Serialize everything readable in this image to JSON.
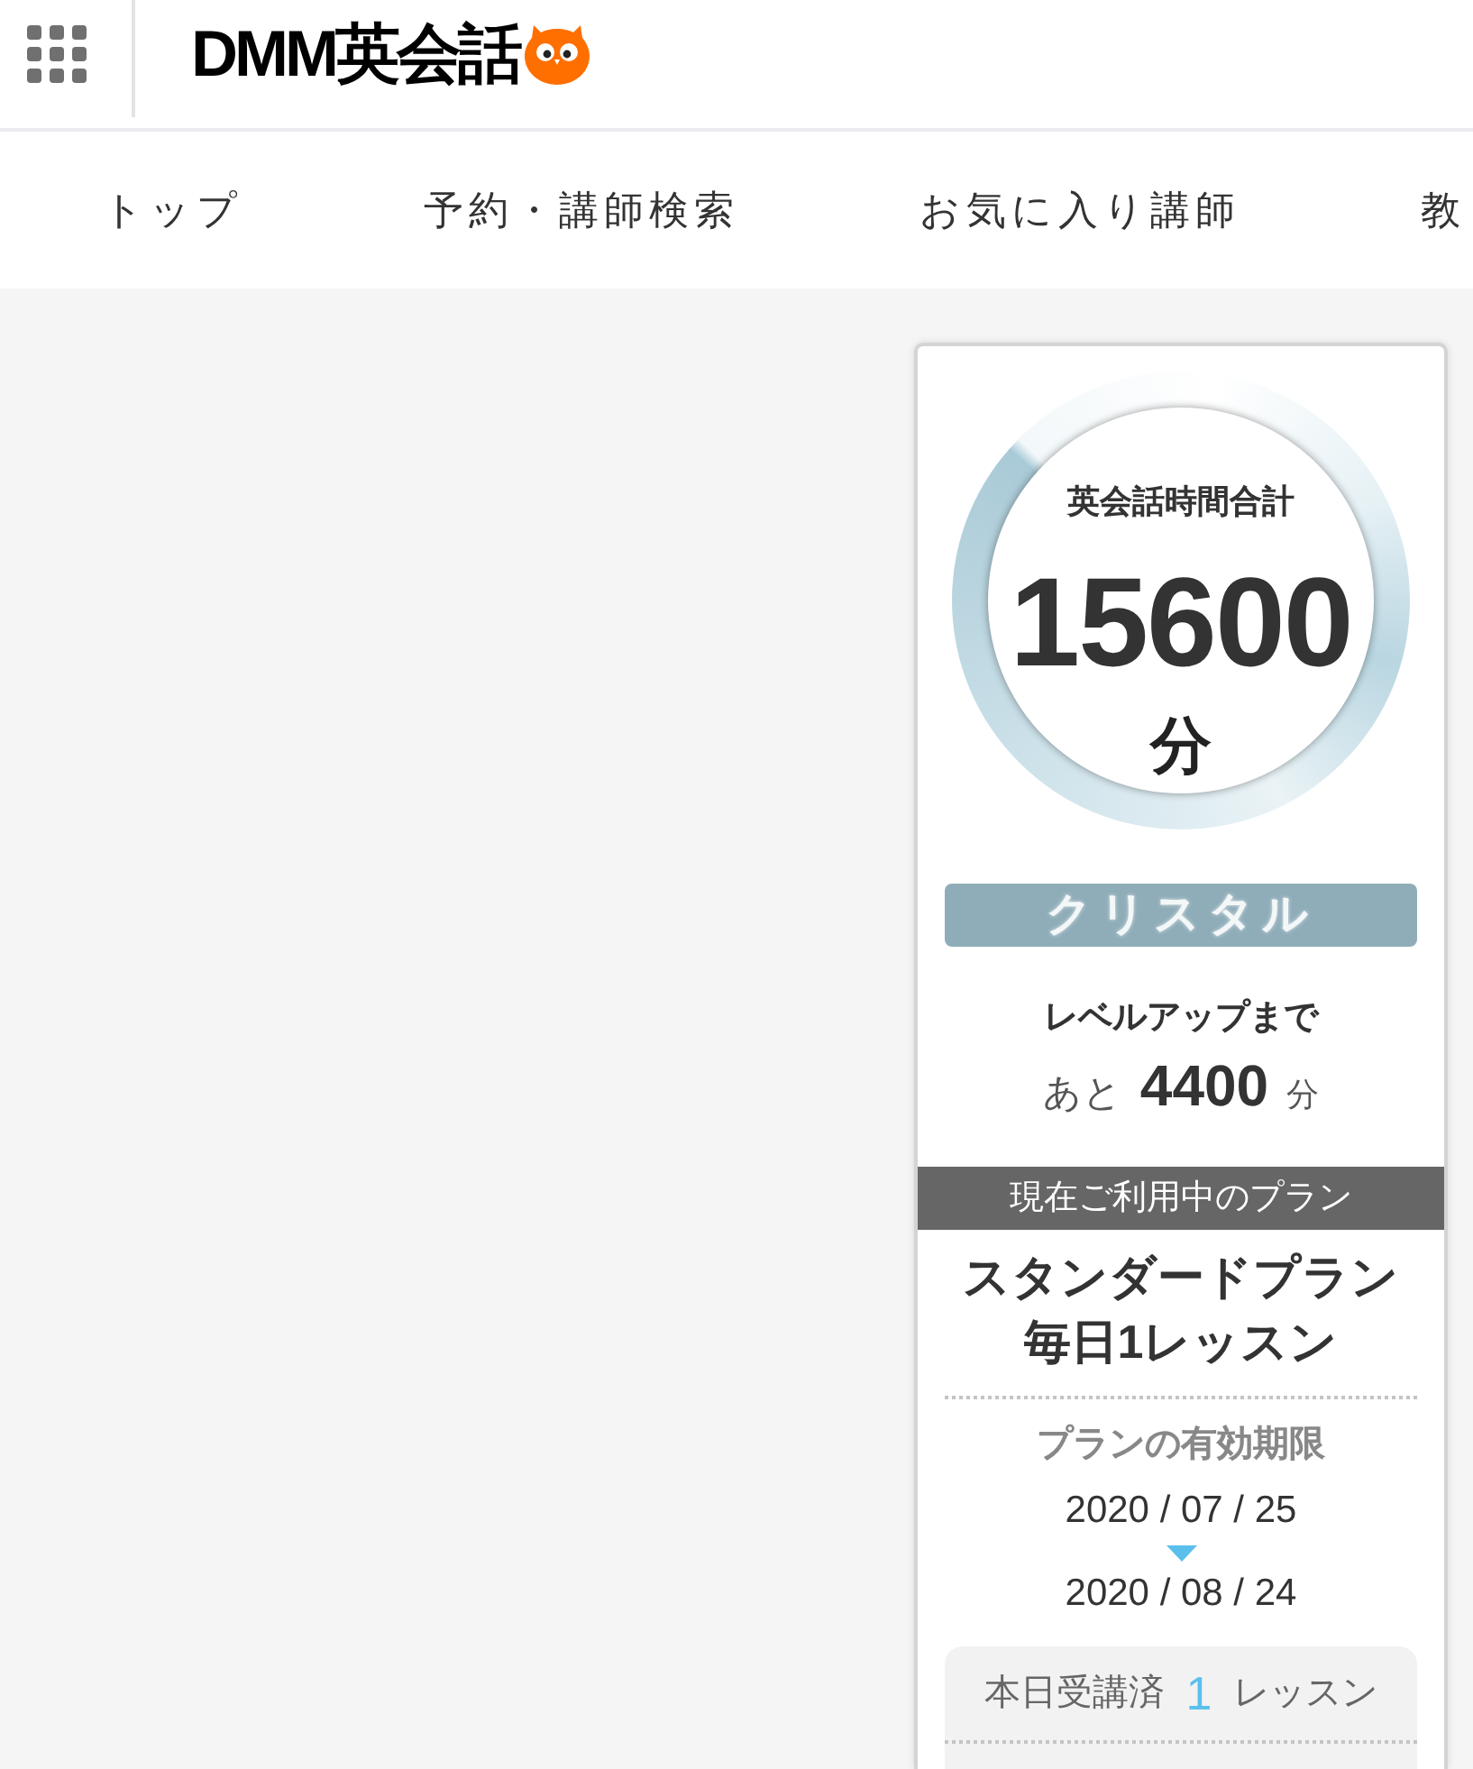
{
  "header": {
    "logo_text": "DMM英会話"
  },
  "nav": {
    "items": [
      {
        "label": "トップ"
      },
      {
        "label": "予約・講師検索"
      },
      {
        "label": "お気に入り講師"
      },
      {
        "label": "教"
      }
    ]
  },
  "summary_card": {
    "total_label": "英会話時間合計",
    "total_value": "15600",
    "total_unit": "分",
    "rank": "クリスタル",
    "next_level_label": "レベルアップまで",
    "remaining_prefix": "あと",
    "remaining_value": "4400",
    "remaining_unit": "分"
  },
  "plan": {
    "heading": "現在ご利用中のプラン",
    "name": "スタンダードプラン",
    "detail": "毎日1レッスン",
    "validity_label": "プランの有効期限",
    "start_date": "2020 / 07 / 25",
    "end_date": "2020 / 08 / 24"
  },
  "today": {
    "label": "本日受講済",
    "count": "1",
    "unit": "レッスン"
  }
}
